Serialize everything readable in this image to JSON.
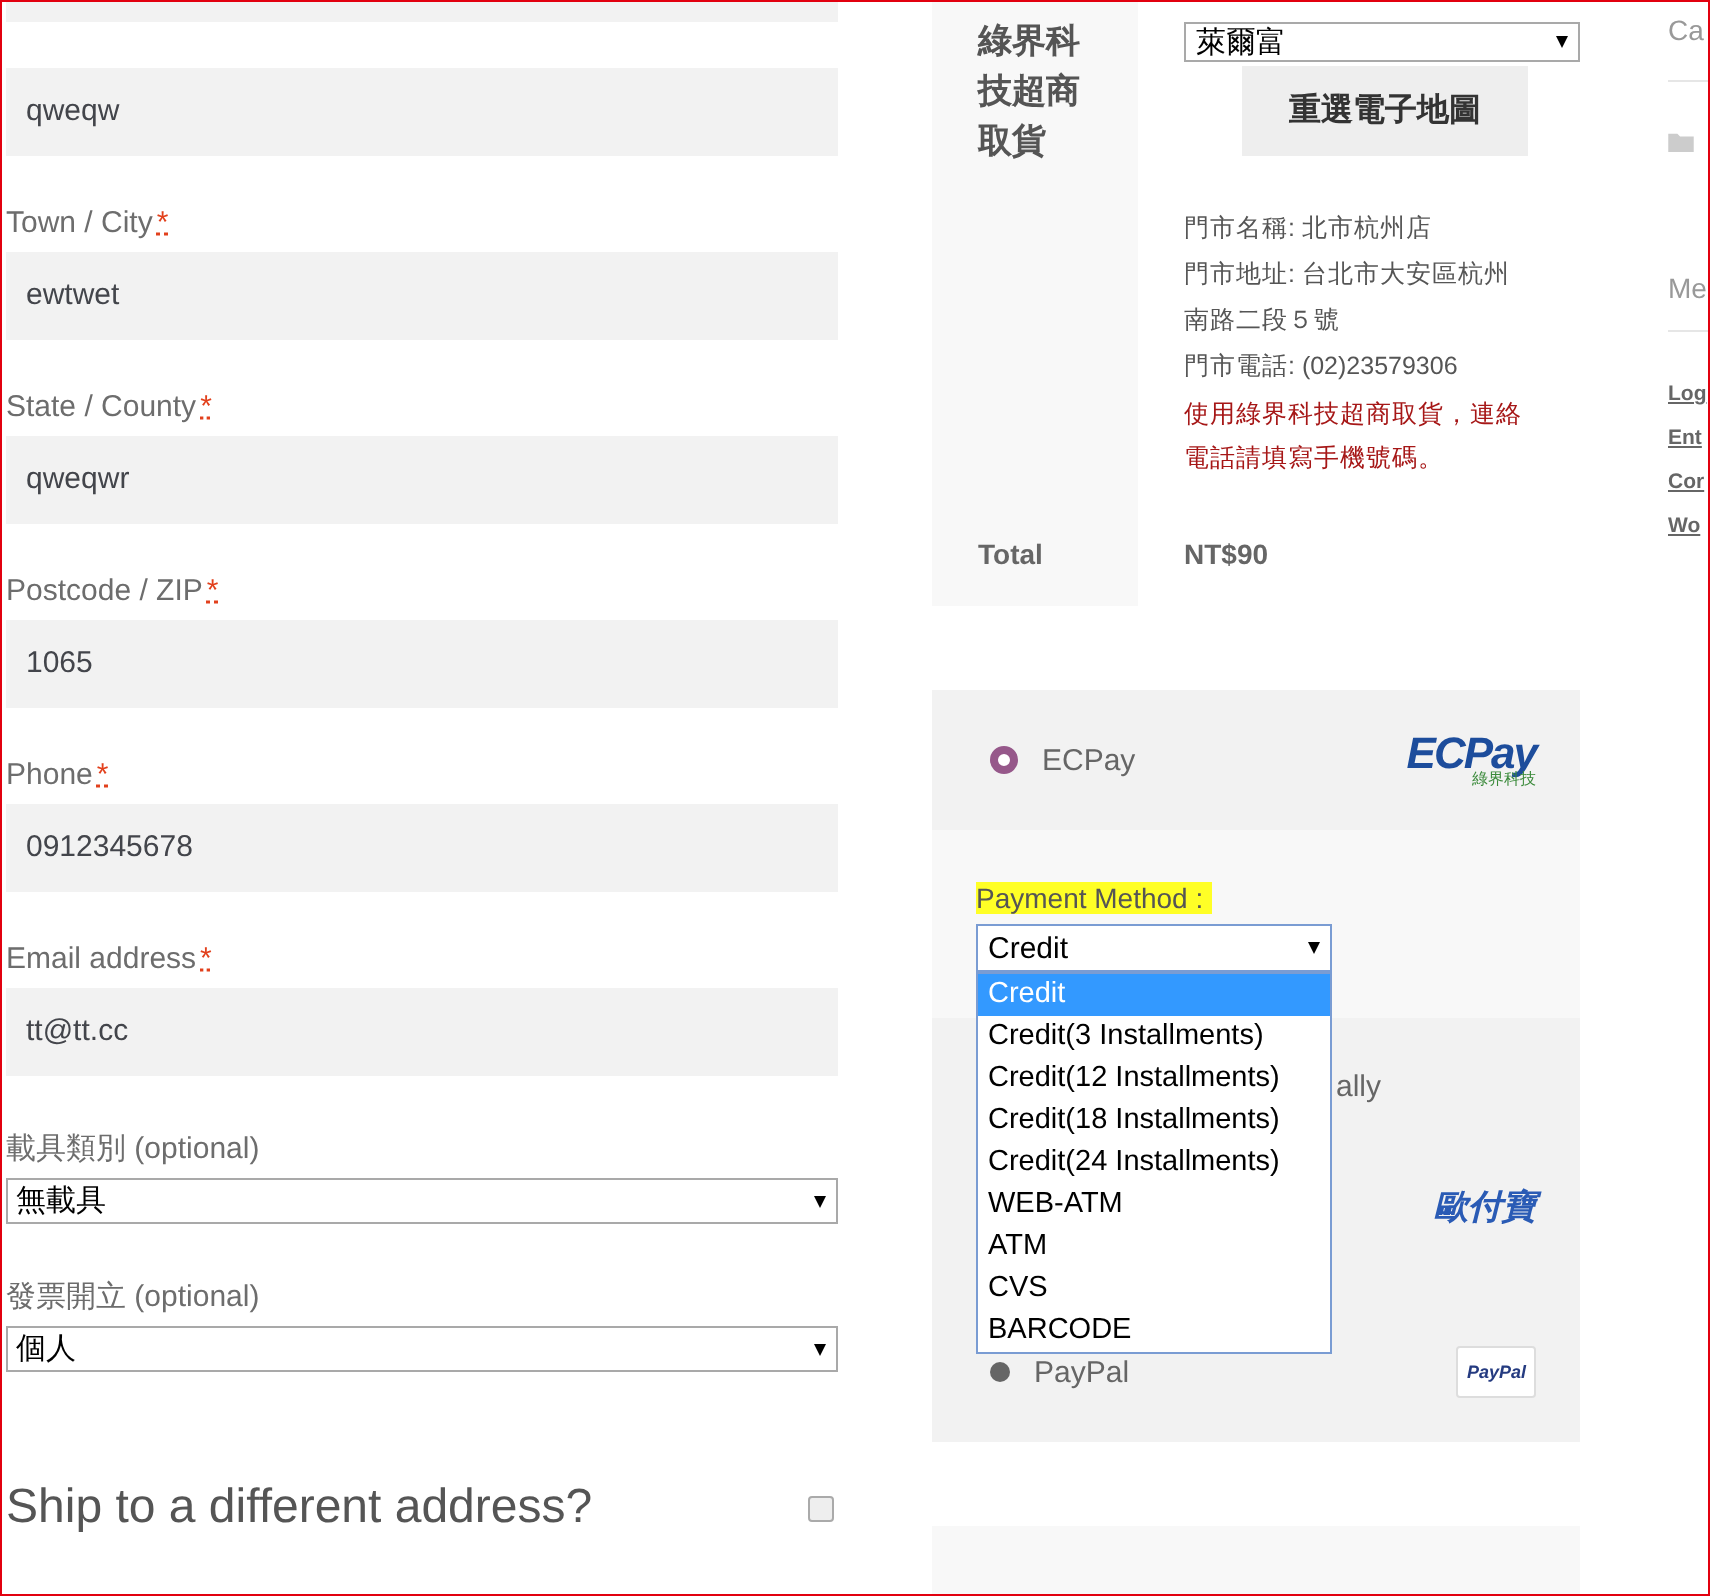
{
  "billing_fields": [
    {
      "value": "qweqw"
    },
    {
      "label": "Town / City",
      "required_mark": "*",
      "value": "ewtwet"
    },
    {
      "label": "State / County",
      "required_mark": "*",
      "value": "qweqwr"
    },
    {
      "label": "Postcode / ZIP",
      "required_mark": "*",
      "value": "1065"
    },
    {
      "label": "Phone",
      "required_mark": "*",
      "value": "0912345678"
    },
    {
      "label": "Email address",
      "required_mark": "*",
      "value": "tt@tt.cc"
    }
  ],
  "billing_selects": [
    {
      "label": "載具類別",
      "suffix": "(optional)",
      "value": "無載具"
    },
    {
      "label": "發票開立",
      "suffix": "(optional)",
      "value": "個人"
    }
  ],
  "ship_to_different": {
    "label": "Ship to a different address?",
    "checked": false
  },
  "shipping": {
    "label": "綠界科技超商取貨",
    "store_select": "萊爾富",
    "button": "重選電子地圖",
    "info": [
      "門市名稱: 北市杭州店",
      "門市地址: 台北市大安區杭州南路二段５號",
      "門市電話: (02)23579306"
    ],
    "warning": "使用綠界科技超商取貨，連絡電話請填寫手機號碼。"
  },
  "total": {
    "label": "Total",
    "value": "NT$90"
  },
  "payment": {
    "methods": [
      {
        "kind": "radio",
        "name": "ECPay",
        "selected": true,
        "logo": {
          "kind": "ecpay",
          "text": "ECPay",
          "subtext": "綠界科技"
        }
      },
      {
        "kind": "covered",
        "name": "ally",
        "logo": {
          "kind": "allpay",
          "text": "歐付寶"
        }
      },
      {
        "kind": "radio",
        "name": "PayPal",
        "selected": false,
        "logo": {
          "kind": "paypal",
          "text": "PayPal"
        }
      }
    ],
    "method_label": "Payment Method :",
    "method_select": "Credit",
    "options": [
      {
        "label": "Credit",
        "selected": true
      },
      {
        "label": "Credit(3 Installments)",
        "selected": false
      },
      {
        "label": "Credit(12 Installments)",
        "selected": false
      },
      {
        "label": "Credit(18 Installments)",
        "selected": false
      },
      {
        "label": "Credit(24 Installments)",
        "selected": false
      },
      {
        "label": "WEB-ATM",
        "selected": false
      },
      {
        "label": "ATM",
        "selected": false
      },
      {
        "label": "CVS",
        "selected": false
      },
      {
        "label": "BARCODE",
        "selected": false
      }
    ]
  },
  "sidebar": {
    "headings": [
      "Ca",
      "Me"
    ],
    "links": [
      "Log",
      "Ent",
      "Cor",
      "Wo"
    ]
  }
}
